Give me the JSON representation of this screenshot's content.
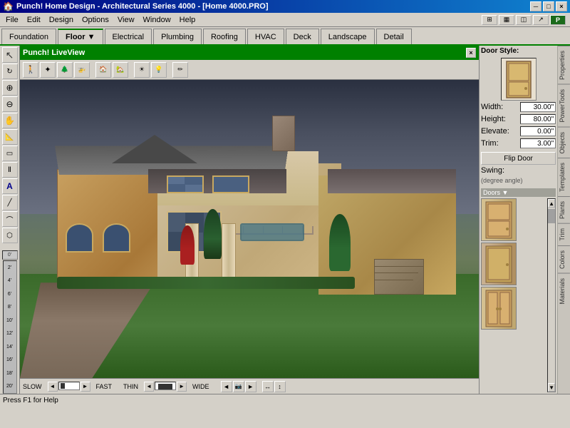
{
  "titleBar": {
    "title": "Punch! Home Design - Architectural Series 4000 - [Home 4000.PRO]",
    "minBtn": "─",
    "maxBtn": "□",
    "closeBtn": "×"
  },
  "menuBar": {
    "items": [
      "File",
      "Edit",
      "Design",
      "Options",
      "View",
      "Window",
      "Help"
    ]
  },
  "tabs": [
    {
      "label": "Foundation",
      "active": false
    },
    {
      "label": "Floor ▼",
      "active": true
    },
    {
      "label": "Electrical",
      "active": false
    },
    {
      "label": "Plumbing",
      "active": false
    },
    {
      "label": "Roofing",
      "active": false
    },
    {
      "label": "HVAC",
      "active": false
    },
    {
      "label": "Deck",
      "active": false
    },
    {
      "label": "Landscape",
      "active": false
    },
    {
      "label": "Detail",
      "active": false
    }
  ],
  "liveView": {
    "title": "Punch! LiveView",
    "closeBtn": "×"
  },
  "liveViewTools": [
    "✦",
    "🚁",
    "🌲",
    "🏠",
    "💡",
    "✏"
  ],
  "leftTools": [
    "↖",
    "↗",
    "⊕",
    "⊞",
    "✏",
    "📐",
    "🔲",
    "⬜",
    "🔷",
    "🔸",
    "Ⅰ",
    "⬡"
  ],
  "bottomBar": {
    "slow": "SLOW",
    "fast": "FAST",
    "thin": "THIN",
    "wide": "WIDE",
    "navArrows": [
      "◄",
      "▶",
      "▲",
      "▼"
    ]
  },
  "statusBar": {
    "text": "Press F1 for Help"
  },
  "rightPanel": {
    "doorStyle": {
      "label": "Door Style:",
      "widthLabel": "Width:",
      "widthValue": "30.00\"",
      "heightLabel": "Height:",
      "heightValue": "80.00\"",
      "elevateLabel": "Elevate:",
      "elevateValue": "0.00\"",
      "trimLabel": "Trim:",
      "trimValue": "3.00\"",
      "flipDoorLabel": "Flip Door",
      "swingLabel": "Swing:",
      "swingHint": "(degree angle)"
    },
    "sectionLabel": "Doors ▼",
    "vertTabs": [
      "Properties",
      "PowerTools",
      "Objects",
      "Templates",
      "Plants",
      "Trim",
      "Colors",
      "Materials"
    ]
  }
}
